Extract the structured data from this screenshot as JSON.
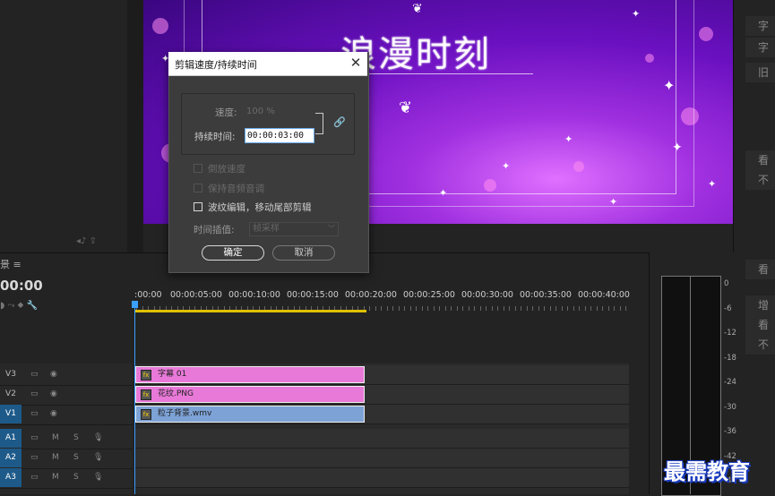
{
  "monitor": {
    "title_text": "浪漫时刻"
  },
  "right_panel_tabs": [
    "字",
    "字",
    "旧",
    "歌",
    "看",
    "不",
    "看",
    "增",
    "看",
    "不"
  ],
  "timeline": {
    "tab_label": "景 ≡",
    "timecode": "00:00",
    "ruler_labels": [
      ":00:00",
      "00:00:05:00",
      "00:00:10:00",
      "00:00:15:00",
      "00:00:20:00",
      "00:00:25:00",
      "00:00:30:00",
      "00:00:35:00",
      "00:00:40:00"
    ],
    "tracks": [
      {
        "label": "V3",
        "type": "video"
      },
      {
        "label": "V2",
        "type": "video"
      },
      {
        "label": "V1",
        "type": "video"
      },
      {
        "label": "A1",
        "type": "audio"
      },
      {
        "label": "A2",
        "type": "audio"
      },
      {
        "label": "A3",
        "type": "audio"
      }
    ],
    "clips": [
      {
        "name": "字幕 01",
        "color": "#e879d8"
      },
      {
        "name": "花纹.PNG",
        "color": "#e879d8"
      },
      {
        "name": "粒子背景.wmv",
        "color": "#7da2d6"
      }
    ]
  },
  "meter": {
    "db_labels": [
      "0",
      "-6",
      "-12",
      "-18",
      "-24",
      "-30",
      "-36",
      "-42",
      "-48"
    ]
  },
  "dialog": {
    "title": "剪辑速度/持续时间",
    "speed_label": "速度:",
    "speed_value": "100 %",
    "duration_label": "持续时间:",
    "duration_value": "00:00:03:00",
    "reverse_label": "倒放速度",
    "keep_pitch_label": "保持音频音调",
    "ripple_label": "波纹编辑，移动尾部剪辑",
    "interp_label": "时间插值:",
    "interp_value": "帧采样",
    "ok_label": "确定",
    "cancel_label": "取消"
  },
  "watermark": "最需教育",
  "colors": {
    "accent": "#1d5a8a",
    "playhead": "#3aa0ff",
    "workbar": "#e0c000"
  }
}
